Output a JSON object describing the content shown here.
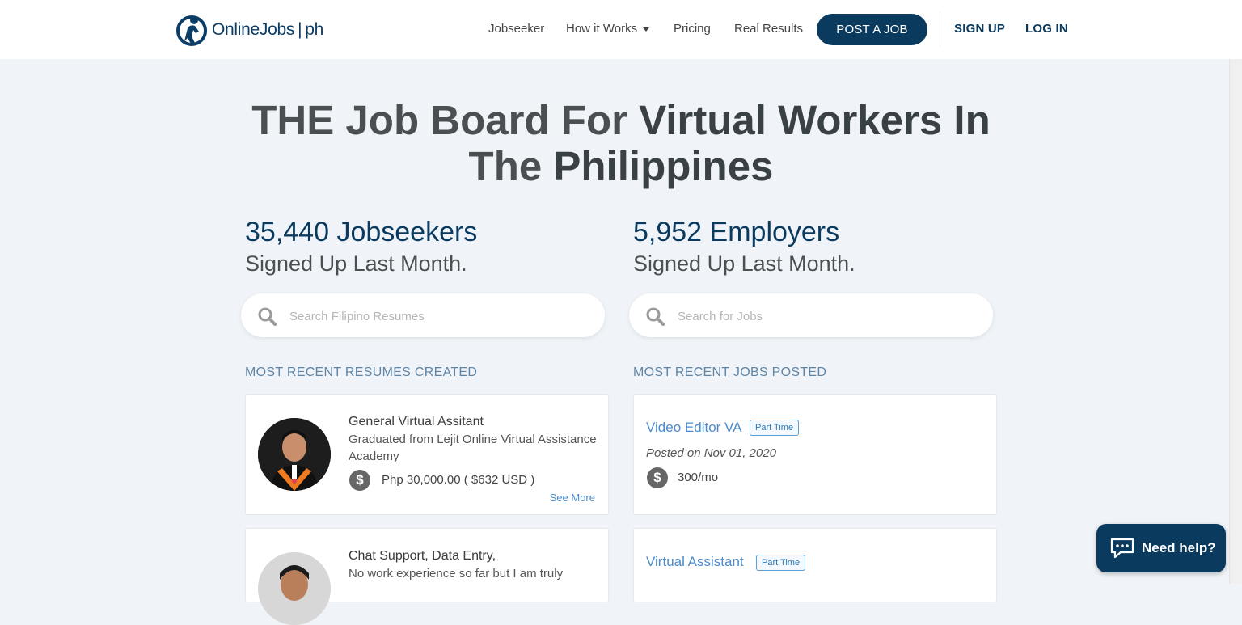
{
  "header": {
    "logo_text": "OnlineJobs",
    "logo_suffix": "ph",
    "nav": {
      "jobseeker": "Jobseeker",
      "how_it_works": "How it Works",
      "pricing": "Pricing",
      "real_results": "Real Results"
    },
    "post_job": "POST A JOB",
    "sign_up": "SIGN UP",
    "log_in": "LOG IN"
  },
  "hero": {
    "part1": "THE Job Board For ",
    "part2": "Virtual Workers In",
    "part3": "The ",
    "part4": "Philippines"
  },
  "stats": {
    "jobseekers": "35,440 Jobseekers",
    "jobseekers_sub": "Signed Up Last Month.",
    "employers": "5,952 Employers",
    "employers_sub": "Signed Up Last Month."
  },
  "search": {
    "resumes_placeholder": "Search Filipino Resumes",
    "jobs_placeholder": "Search for Jobs"
  },
  "resumes": {
    "section_title": "MOST RECENT RESUMES CREATED",
    "items": [
      {
        "title": "General Virtual Assitant",
        "desc": "Graduated from Lejit Online Virtual Assistance Academy",
        "price": "Php 30,000.00 ( $632 USD )",
        "see_more": "See More"
      },
      {
        "title": "Chat Support, Data Entry,",
        "desc": "No work experience so far but I am truly"
      }
    ]
  },
  "jobs": {
    "section_title": "MOST RECENT JOBS POSTED",
    "items": [
      {
        "title": "Video Editor VA",
        "badge": "Part Time",
        "posted": "Posted on Nov 01, 2020",
        "rate": "300/mo"
      },
      {
        "title": "Virtual Assistant",
        "badge": "Part Time"
      }
    ]
  },
  "help": {
    "label": "Need help?"
  },
  "colors": {
    "brand": "#0b3a5f",
    "link": "#4a8ccc",
    "background": "#f0f4f8"
  }
}
